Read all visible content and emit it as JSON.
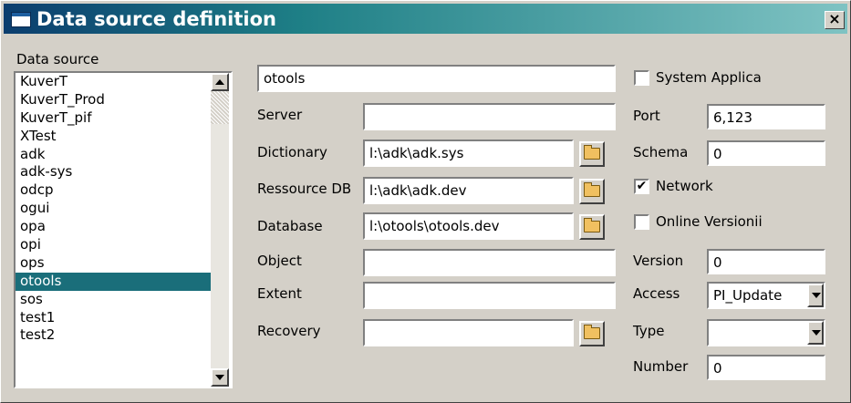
{
  "window": {
    "title": "Data source definition",
    "close_label": "×"
  },
  "datasource": {
    "label": "Data source",
    "items": [
      "KuverT",
      "KuverT_Prod",
      "KuverT_pif",
      "XTest",
      "adk",
      "adk-sys",
      "odcp",
      "ogui",
      "opa",
      "opi",
      "ops",
      "otools",
      "sos",
      "test1",
      "test2"
    ],
    "selected": "otools"
  },
  "form": {
    "name_value": "otools",
    "server_label": "Server",
    "server_value": "",
    "dictionary_label": "Dictionary",
    "dictionary_value": "l:\\adk\\adk.sys",
    "ressource_label": "Ressource DB",
    "ressource_value": "l:\\adk\\adk.dev",
    "database_label": "Database",
    "database_value": "l:\\otools\\otools.dev",
    "object_label": "Object",
    "object_value": "",
    "extent_label": "Extent",
    "extent_value": "",
    "recovery_label": "Recovery",
    "recovery_value": ""
  },
  "options": {
    "system_label": "System Applica",
    "system_checked": false,
    "port_label": "Port",
    "port_value": "6,123",
    "schema_label": "Schema",
    "schema_value": "0",
    "network_label": "Network",
    "network_checked": true,
    "online_label": "Online Versionii",
    "online_checked": false,
    "version_label": "Version",
    "version_value": "0",
    "access_label": "Access",
    "access_value": "PI_Update",
    "type_label": "Type",
    "type_value": "",
    "number_label": "Number",
    "number_value": "0",
    "check_mark": "✔"
  },
  "colors": {
    "selection": "#1a6e7a",
    "title_start": "#0b3d6e",
    "title_end": "#7fc3c3"
  },
  "icons": {
    "browse": "folder-icon",
    "window": "window-icon"
  }
}
